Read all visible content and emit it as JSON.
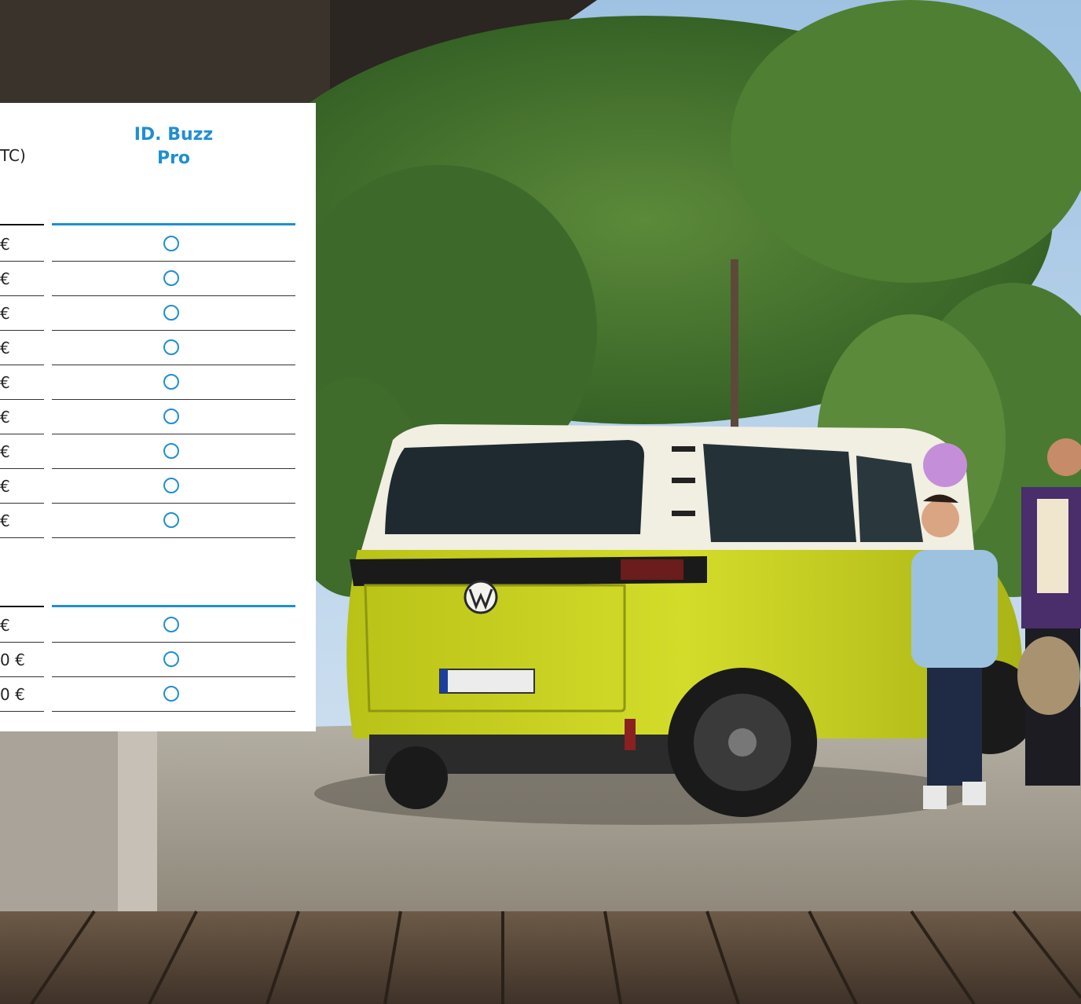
{
  "table": {
    "header_left_fragment": "TC)",
    "column": {
      "title_line1": "ID. Buzz",
      "title_line2": "Pro"
    },
    "section1_rows": [
      {
        "price": "€"
      },
      {
        "price": "€"
      },
      {
        "price": "€"
      },
      {
        "price": "€"
      },
      {
        "price": "€"
      },
      {
        "price": "€"
      },
      {
        "price": "€"
      },
      {
        "price": "€"
      },
      {
        "price": "€"
      }
    ],
    "section2_rows": [
      {
        "price": "€"
      },
      {
        "price": "0 €"
      },
      {
        "price": "0 €"
      }
    ]
  },
  "colors": {
    "accent_blue": "#1f8fd1",
    "van_yellow": "#c8d21c",
    "van_white": "#f1eee2"
  },
  "icons": [
    "radio-empty-icon",
    "vw-logo-icon"
  ]
}
